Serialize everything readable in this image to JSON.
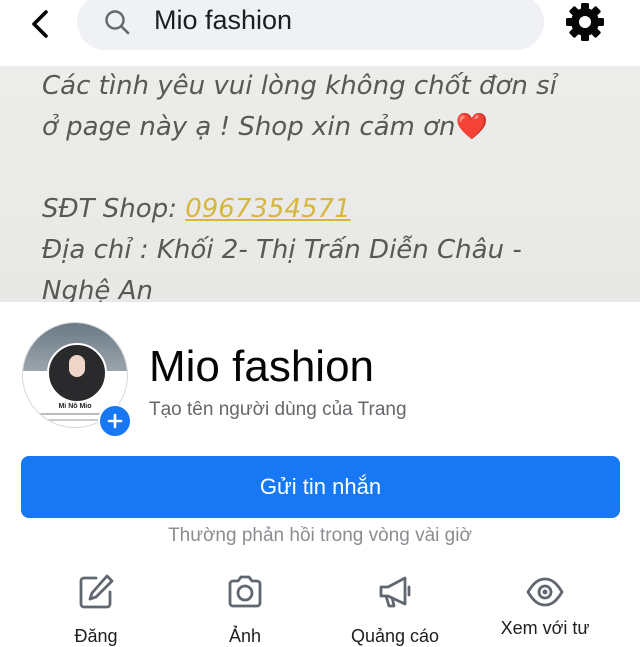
{
  "search": {
    "query": "Mio fashion"
  },
  "cover": {
    "lines": [
      "Các tình yêu vui lòng không chốt đơn sỉ",
      "ở page này ạ ! Shop xin cảm ơn",
      "",
      "SĐT Shop: ",
      "Địa chỉ : Khối 2- Thị Trấn Diễn Châu -",
      "Nghệ An"
    ],
    "heart": "❤️",
    "phone": "0967354571"
  },
  "profile": {
    "avatar_text": "Mi Nô Mio",
    "name": "Mio fashion",
    "username_prompt": "Tạo tên người dùng của Trang",
    "message_button": "Gửi tin nhắn",
    "response_time": "Thường phản hồi trong vòng vài giờ"
  },
  "actions": [
    {
      "label": "Đăng",
      "icon": "edit-icon"
    },
    {
      "label": "Ảnh",
      "icon": "camera-icon"
    },
    {
      "label": "Quảng cáo",
      "icon": "megaphone-icon"
    },
    {
      "label": "Xem với tư",
      "icon": "eye-icon"
    }
  ],
  "colors": {
    "accent": "#1877f2",
    "phone_link": "#d6b73b",
    "cover_text": "#585856"
  }
}
